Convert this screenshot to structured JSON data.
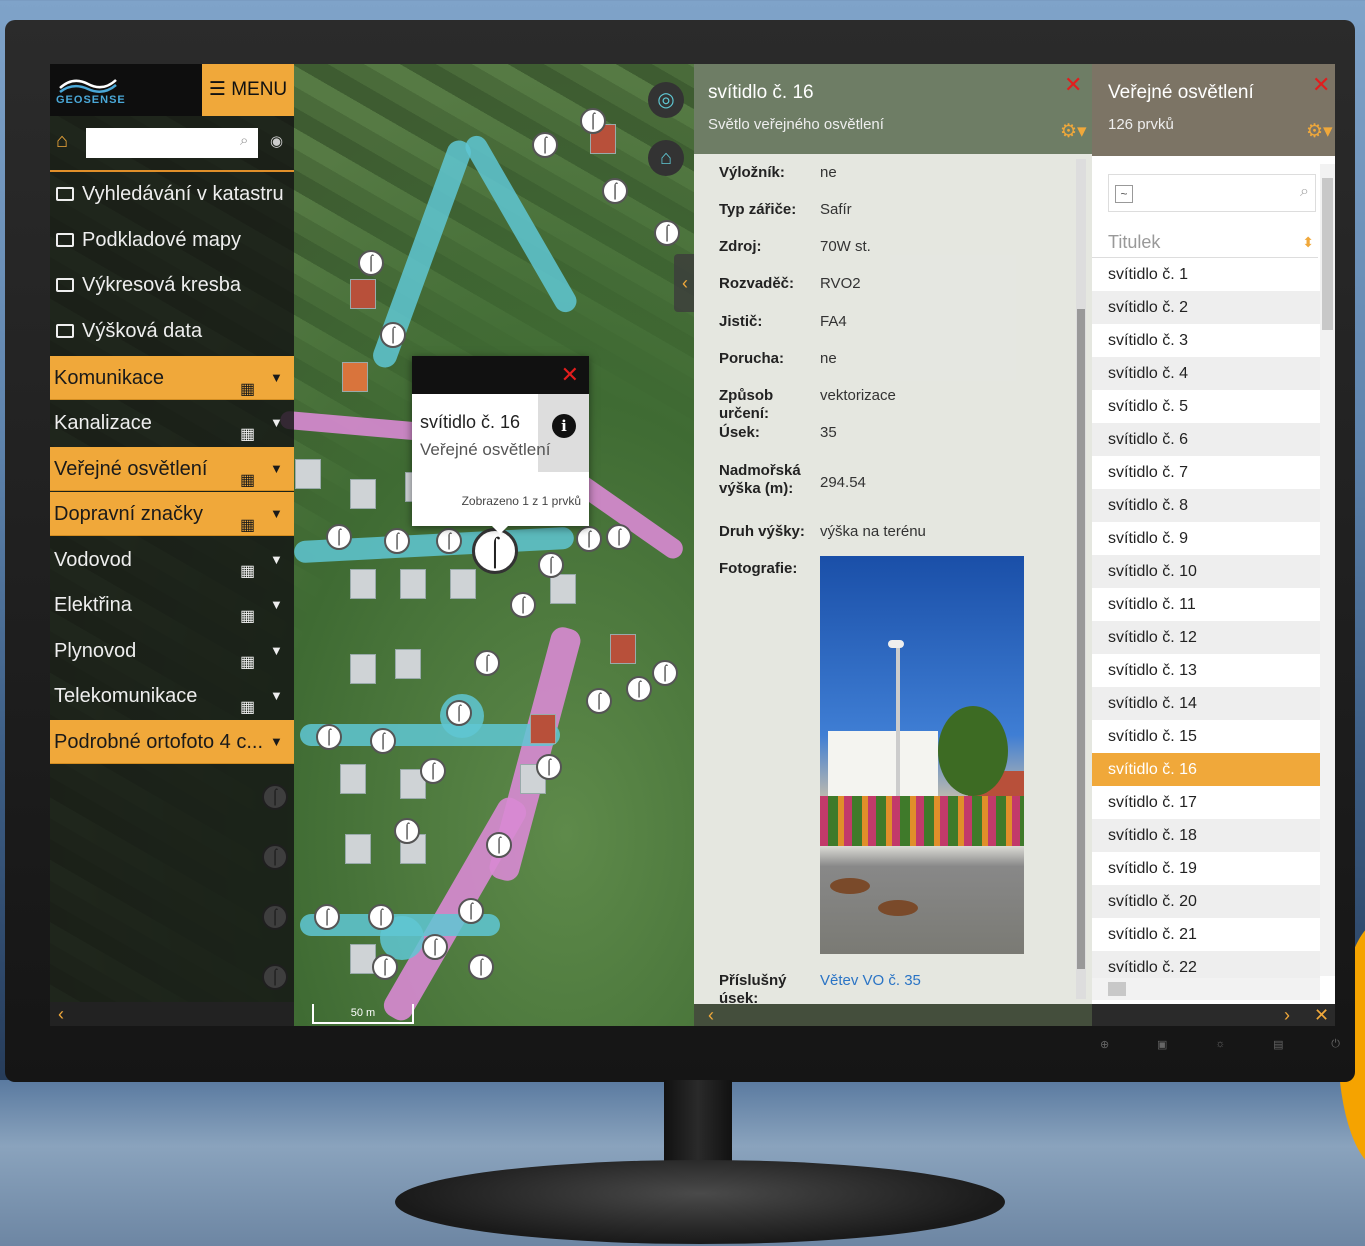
{
  "sidebar": {
    "logo_text": "GEOSENSE",
    "menu_label": "MENU",
    "search_placeholder": "",
    "folders": [
      {
        "label": "Vyhledávání v katastru"
      },
      {
        "label": "Podkladové mapy"
      },
      {
        "label": "Výkresová kresba"
      },
      {
        "label": "Výšková data"
      }
    ],
    "layers": [
      {
        "label": "Komunikace",
        "active": true
      },
      {
        "label": "Kanalizace",
        "active": false
      },
      {
        "label": "Veřejné osvětlení",
        "active": true
      },
      {
        "label": "Dopravní značky",
        "active": true
      },
      {
        "label": "Vodovod",
        "active": false
      },
      {
        "label": "Elektřina",
        "active": false
      },
      {
        "label": "Plynovod",
        "active": false
      },
      {
        "label": "Telekomunikace",
        "active": false
      },
      {
        "label": "Podrobné ortofoto 4 c...",
        "active": true
      }
    ]
  },
  "map": {
    "scale_label": "50 m"
  },
  "popup": {
    "title": "svítidlo č. 16",
    "subtitle": "Veřejné osvětlení",
    "footer": "Zobrazeno 1 z 1 prvků"
  },
  "detail": {
    "title": "svítidlo č. 16",
    "subtitle": "Světlo veřejného osvětlení",
    "rows": [
      {
        "label": "Výložník:",
        "value": "ne"
      },
      {
        "label": "Typ zářiče:",
        "value": "Safír"
      },
      {
        "label": "Zdroj:",
        "value": "70W st."
      },
      {
        "label": "Rozvaděč:",
        "value": "RVO2"
      },
      {
        "label": "Jistič:",
        "value": "FA4"
      },
      {
        "label": "Porucha:",
        "value": "ne"
      },
      {
        "label": "Způsob určení:",
        "value": "vektorizace"
      },
      {
        "label": "Úsek:",
        "value": "35"
      },
      {
        "label": "Nadmořská výška (m):",
        "value": "294.54"
      },
      {
        "label": "Druh výšky:",
        "value": "výška na terénu"
      },
      {
        "label": "Fotografie:",
        "value": ""
      }
    ],
    "segment_label": "Příslušný úsek:",
    "segment_link": "Větev VO č. 35"
  },
  "list": {
    "title": "Veřejné osvětlení",
    "count": "126 prvků",
    "column_header": "Titulek",
    "items": [
      "svítidlo č. 1",
      "svítidlo č. 2",
      "svítidlo č. 3",
      "svítidlo č. 4",
      "svítidlo č. 5",
      "svítidlo č. 6",
      "svítidlo č. 7",
      "svítidlo č. 8",
      "svítidlo č. 9",
      "svítidlo č. 10",
      "svítidlo č. 11",
      "svítidlo č. 12",
      "svítidlo č. 13",
      "svítidlo č. 14",
      "svítidlo č. 15",
      "svítidlo č. 16",
      "svítidlo č. 17",
      "svítidlo č. 18",
      "svítidlo č. 19",
      "svítidlo č. 20",
      "svítidlo č. 21",
      "svítidlo č. 22"
    ],
    "selected_item": "svítidlo č. 16"
  },
  "colors": {
    "accent": "#f0a83a",
    "close_red": "#e21d1d",
    "link_blue": "#2a74c5",
    "road_cyan": "#5fc7d3",
    "road_pink": "#d889d3"
  },
  "icons": [
    "home-icon",
    "search-icon",
    "eye-icon",
    "folder-icon",
    "table-icon",
    "chevron-down-icon",
    "close-icon",
    "info-icon",
    "target-icon",
    "map-home-icon",
    "street-lamp-icon",
    "tools-icon",
    "sort-icon"
  ]
}
